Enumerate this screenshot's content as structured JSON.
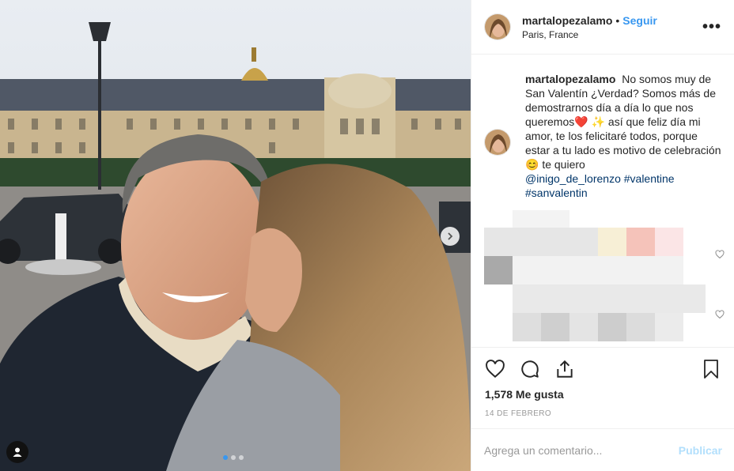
{
  "post": {
    "username": "martalopezalamo",
    "follow_label": "Seguir",
    "separator": "•",
    "location": "Paris, France",
    "more_label": "•••"
  },
  "caption": {
    "username": "martalopezalamo",
    "text_1": "No somos muy de San Valentín ¿Verdad? Somos más de demostrarnos día a día lo que nos queremos",
    "emoji_heart": "❤️",
    "emoji_sparkles": "✨",
    "text_2": " así que feliz día mi amor, te los felicitaré todos, porque estar a tu lado es motivo de celebración",
    "emoji_smile": "😊",
    "text_3": " te quiero",
    "mention": "@inigo_de_lorenzo",
    "hashtag_1": "#valentine",
    "hashtag_2": "#sanvalentin"
  },
  "stats": {
    "likes": "1,578 Me gusta",
    "date": "14 DE FEBRERO"
  },
  "comment_box": {
    "placeholder": "Agrega un comentario...",
    "publish_label": "Publicar"
  },
  "carousel": {
    "slides": 3,
    "active": 1
  },
  "icons": {
    "like": "heart-icon",
    "comment": "comment-icon",
    "share": "share-icon",
    "save": "bookmark-icon",
    "next": "chevron-right-icon",
    "tag": "user-tag-icon"
  },
  "colors": {
    "accent": "#3897f0",
    "publish_disabled": "#b2dffc",
    "hashtag": "#003569",
    "muted": "#999999"
  }
}
